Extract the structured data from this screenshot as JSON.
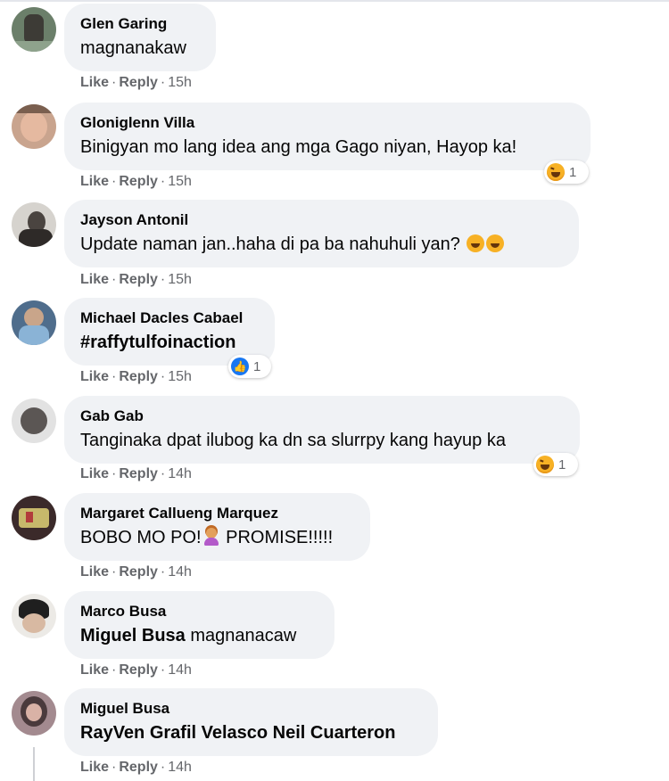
{
  "actions": {
    "like": "Like",
    "reply": "Reply",
    "sep": "·"
  },
  "comments": [
    {
      "author": "Glen Garing",
      "text": "magnanakaw",
      "time": "15h"
    },
    {
      "author": "Gloniglenn Villa",
      "text": "Binigyan mo lang idea ang mga Gago niyan, Hayop ka!",
      "time": "15h",
      "reaction": {
        "icon": "haha-icon",
        "count": "1"
      }
    },
    {
      "author": "Jayson Antonil",
      "text": "Update naman jan..haha di pa ba nahuhuli yan?",
      "time": "15h",
      "emojis": [
        "laughing-icon",
        "laughing-icon"
      ]
    },
    {
      "author": "Michael Dacles Cabael",
      "text": "#raffytulfoinaction",
      "time": "15h",
      "reaction": {
        "icon": "like-icon",
        "count": "1"
      }
    },
    {
      "author": "Gab Gab",
      "text": "Tanginaka dpat ilubog ka dn sa slurrpy kang hayup ka",
      "time": "14h",
      "reaction": {
        "icon": "haha-icon",
        "count": "1"
      }
    },
    {
      "author": "Margaret Callueng Marquez",
      "text_a": "BOBO MO PO!",
      "text_b": " PROMISE!!!!!",
      "emoji": "person-shrugging-icon",
      "time": "14h"
    },
    {
      "author": "Marco Busa",
      "mention": "Miguel Busa",
      "text": " magnanacaw",
      "time": "14h"
    },
    {
      "author": "Miguel Busa",
      "mention": "RayVen Grafil Velasco Neil Cuarteron",
      "time": "14h"
    }
  ]
}
